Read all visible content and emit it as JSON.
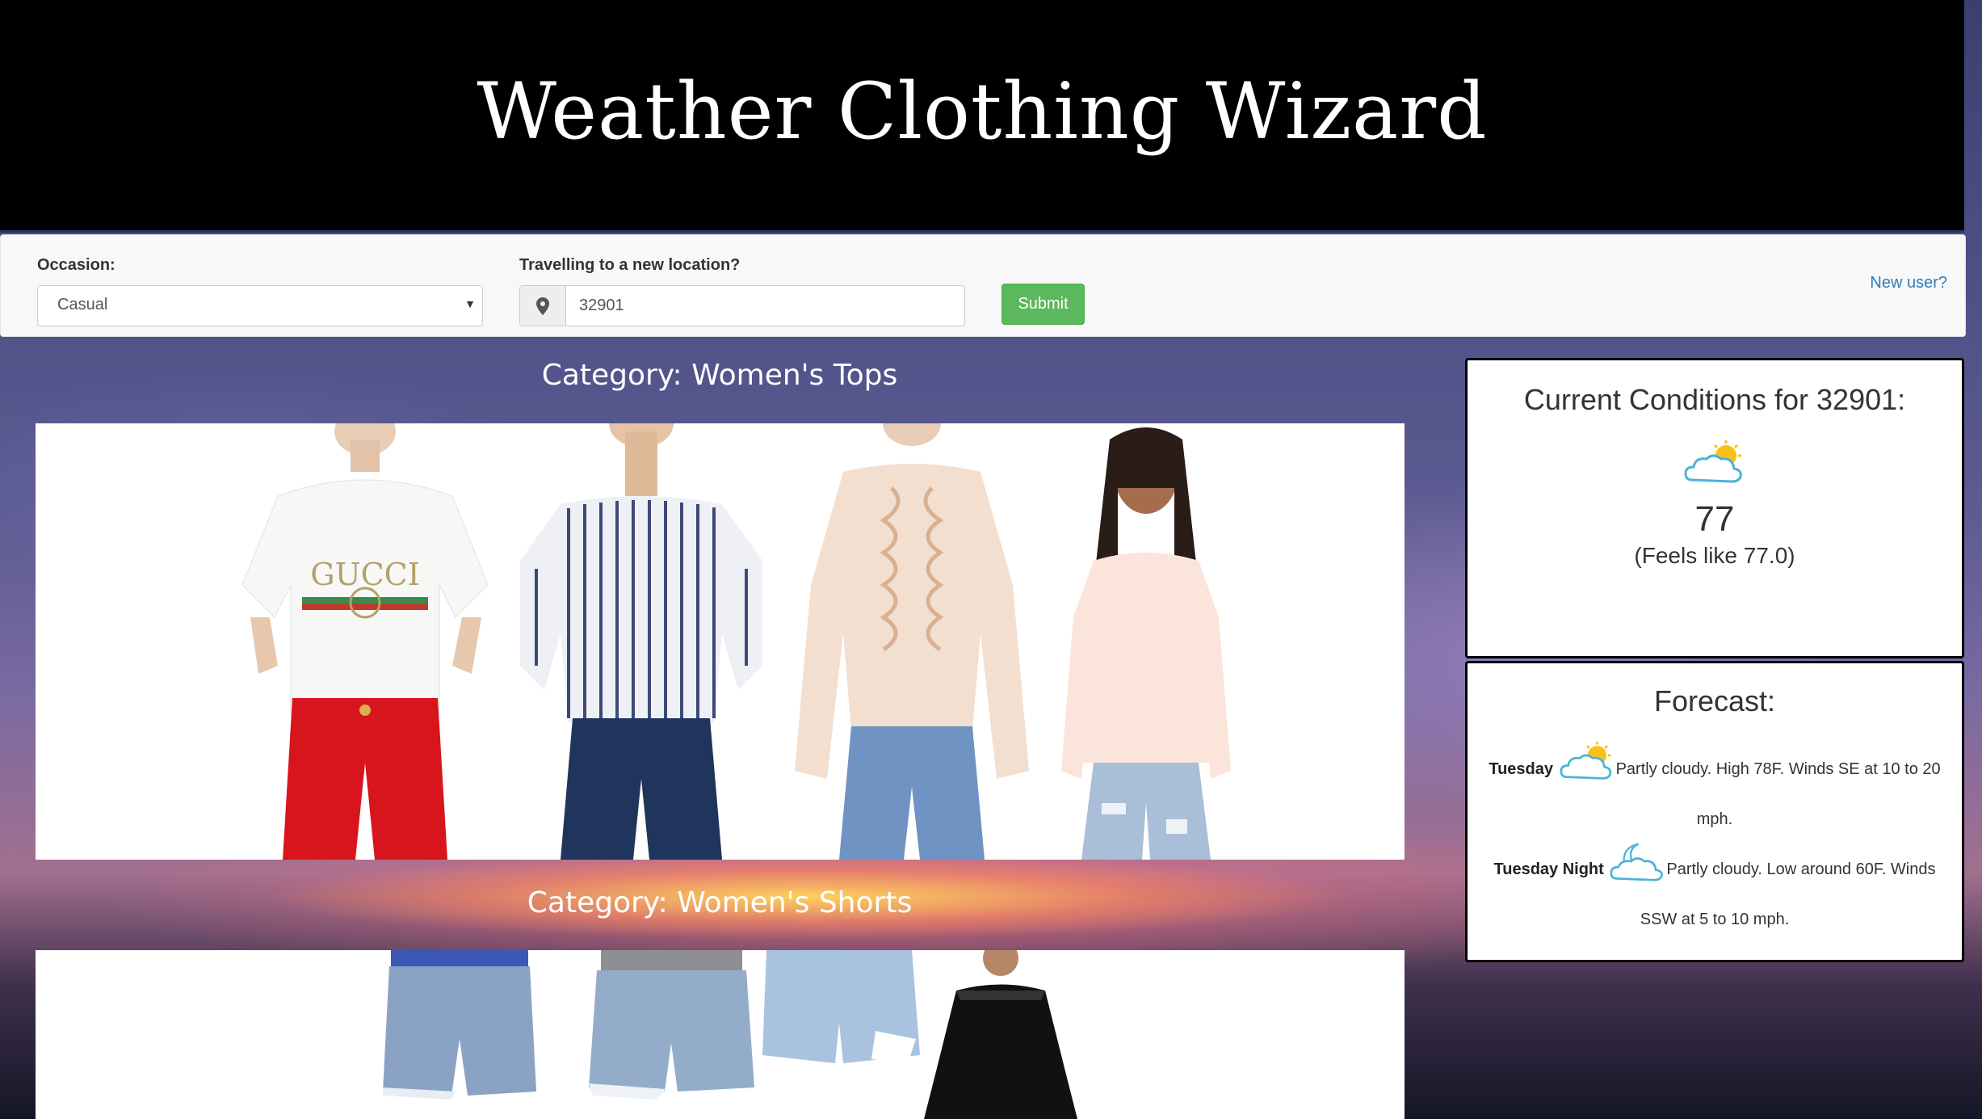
{
  "app": {
    "title": "Weather Clothing Wizard"
  },
  "toolbar": {
    "occasion_label": "Occasion:",
    "occasion_value": "Casual",
    "location_label": "Travelling to a new location?",
    "location_value": "32901",
    "submit_label": "Submit",
    "new_user_link": "New user?",
    "submit_color": "#5cb85c",
    "link_color": "#337ab7"
  },
  "categories": [
    {
      "title": "Category: Women's Tops",
      "items": [
        "GUCCI logo t-shirt with red pants",
        "striped off-shoulder top",
        "ruffled sheer blouse",
        "pink peplum top"
      ]
    },
    {
      "title": "Category: Women's Shorts",
      "items": [
        "denim shorts",
        "distressed denim shorts",
        "light denim shorts",
        "black lace dress"
      ]
    }
  ],
  "current_conditions": {
    "title": "Current Conditions for 32901:",
    "icon": "partly-cloudy-icon",
    "temperature": "77",
    "feels_like": "(Feels like 77.0)"
  },
  "forecast": {
    "title": "Forecast:",
    "periods": [
      {
        "name": "Tuesday",
        "icon": "partly-cloudy-icon",
        "text": "Partly cloudy. High 78F. Winds SE at 10 to 20 mph."
      },
      {
        "name": "Tuesday Night",
        "icon": "partly-cloudy-night-icon",
        "text": "Partly cloudy. Low around 60F. Winds SSW at 5 to 10 mph."
      }
    ]
  }
}
